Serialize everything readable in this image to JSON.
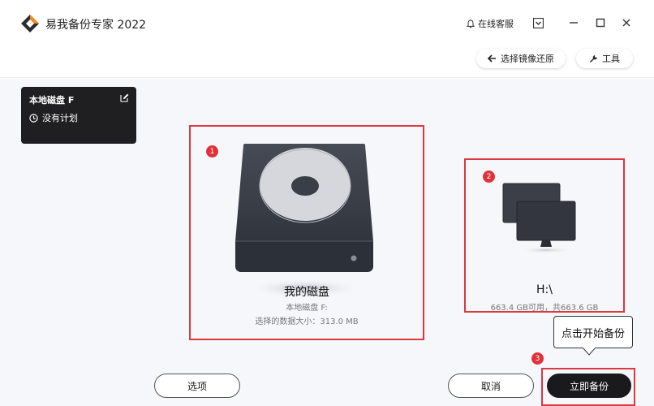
{
  "app": {
    "title": "易我备份专家 2022"
  },
  "header": {
    "support_label": "在线客服",
    "restore_label": "选择镜像还原",
    "tools_label": "工具"
  },
  "plan_card": {
    "name": "本地磁盘 F",
    "schedule": "没有计划"
  },
  "source": {
    "step": "1",
    "title": "我的磁盘",
    "disk": "本地磁盘 F:",
    "size_line": "选择的数据大小：313.0 MB"
  },
  "destination": {
    "step": "2",
    "title": "H:\\",
    "space_line": "663.4 GB可用，共663.6 GB"
  },
  "tooltip": {
    "step": "3",
    "text": "点击开始备份"
  },
  "footer": {
    "options_label": "选项",
    "cancel_label": "取消",
    "backup_label": "立即备份"
  },
  "colors": {
    "accent_red": "#d9393f",
    "dark": "#1a1a1c"
  }
}
